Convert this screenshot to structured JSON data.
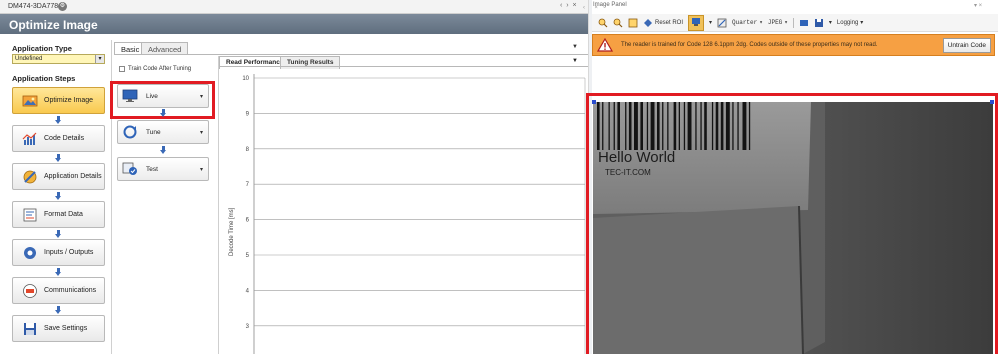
{
  "device": {
    "name": "DM474-3DA778"
  },
  "page_title": "Optimize Image",
  "sidebar": {
    "application_type_label": "Application Type",
    "application_type_value": "Undefined",
    "application_steps_label": "Application Steps",
    "steps": [
      {
        "label": "Optimize Image",
        "icon": "photo-icon",
        "active": true
      },
      {
        "label": "Code Details",
        "icon": "chart-icon"
      },
      {
        "label": "Application Details",
        "icon": "tools-icon"
      },
      {
        "label": "Format Data",
        "icon": "format-icon"
      },
      {
        "label": "Inputs / Outputs",
        "icon": "io-gear-icon"
      },
      {
        "label": "Communications",
        "icon": "network-icon"
      },
      {
        "label": "Save Settings",
        "icon": "floppy-icon"
      }
    ]
  },
  "config": {
    "tabs": [
      "Basic",
      "Advanced"
    ],
    "train_code_label": "Train Code After Tuning",
    "actions": [
      {
        "label": "Live",
        "icon": "monitor-icon"
      },
      {
        "label": "Tune",
        "icon": "tune-icon"
      },
      {
        "label": "Test",
        "icon": "test-icon"
      }
    ]
  },
  "chart": {
    "tabs": [
      "Read Performance",
      "Tuning Results"
    ],
    "ylabel": "Decode Time [ms]"
  },
  "chart_data": {
    "type": "line",
    "title": "",
    "ylabel": "Decode Time [ms]",
    "xlabel": "",
    "y_ticks": [
      10,
      9,
      8,
      7,
      6,
      5,
      4,
      3
    ],
    "ylim": [
      3,
      10
    ],
    "series": [],
    "grid": true
  },
  "image_panel": {
    "title": "Image Panel",
    "toolbar": {
      "reset_roi": "Reset ROI",
      "quality": "Quarter",
      "format": "JPEG",
      "logging": "Logging"
    },
    "banner_text": "The reader is trained for Code 128 6.1ppm 2dg. Codes outside of these properties may not read.",
    "untrain_label": "Untrain Code",
    "camera_text_line1": "Hello World",
    "camera_text_line2": "TEC-IT.COM"
  },
  "colors": {
    "highlight": "#e11b22",
    "banner": "#f6a043",
    "title_band": "#6c7a8a",
    "active_step": "#f9c94e"
  }
}
